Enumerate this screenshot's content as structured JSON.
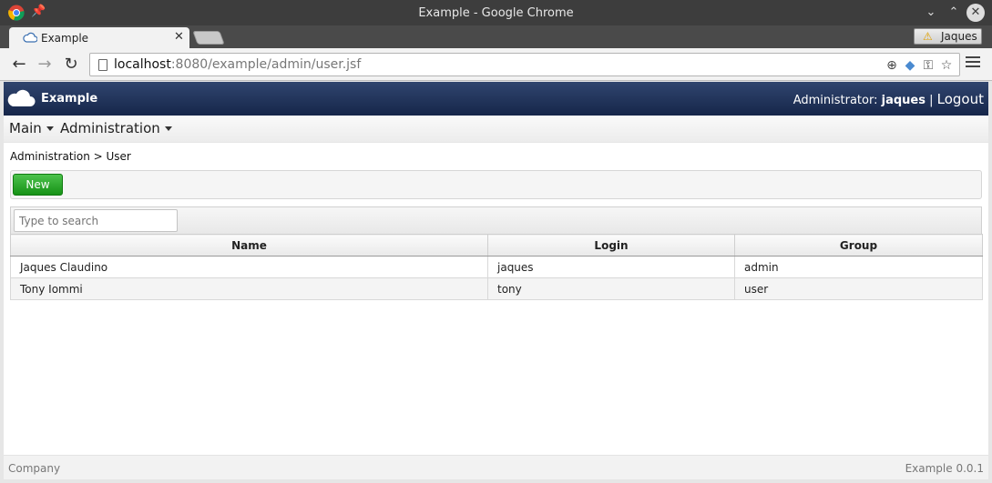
{
  "window": {
    "title": "Example - Google Chrome"
  },
  "tabs": [
    {
      "label": "Example"
    }
  ],
  "profile": {
    "name": "Jaques"
  },
  "address": {
    "host": "localhost",
    "rest": ":8080/example/admin/user.jsf"
  },
  "app": {
    "name": "Example",
    "user_prefix": "Administrator:",
    "user_name": "jaques",
    "separator": "|",
    "logout_label": "Logout"
  },
  "menu": {
    "items": [
      {
        "label": "Main"
      },
      {
        "label": "Administration"
      }
    ]
  },
  "breadcrumb": "Administration > User",
  "toolbar": {
    "new_label": "New"
  },
  "search": {
    "placeholder": "Type to search"
  },
  "table": {
    "columns": [
      "Name",
      "Login",
      "Group"
    ],
    "rows": [
      {
        "name": "Jaques Claudino",
        "login": "jaques",
        "group": "admin"
      },
      {
        "name": "Tony Iommi",
        "login": "tony",
        "group": "user"
      }
    ]
  },
  "footer": {
    "left": "Company",
    "right": "Example 0.0.1"
  },
  "colors": {
    "appbar": "#16264a",
    "new_button": "#169216"
  }
}
